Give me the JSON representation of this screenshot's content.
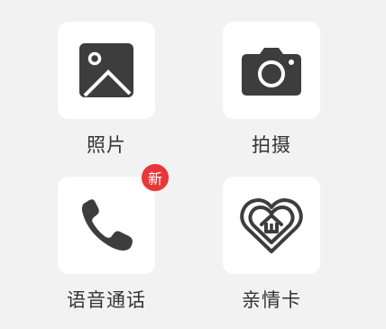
{
  "apps": [
    {
      "label": "照片",
      "icon": "photo-icon"
    },
    {
      "label": "拍摄",
      "icon": "camera-icon"
    },
    {
      "label": "语音通话",
      "icon": "phone-icon",
      "badge": "新"
    },
    {
      "label": "亲情卡",
      "icon": "heart-home-icon"
    }
  ],
  "colors": {
    "background": "#f2f2f2",
    "tile": "#ffffff",
    "icon": "#3d3d3d",
    "badge": "#e8363a",
    "label": "#333333"
  }
}
